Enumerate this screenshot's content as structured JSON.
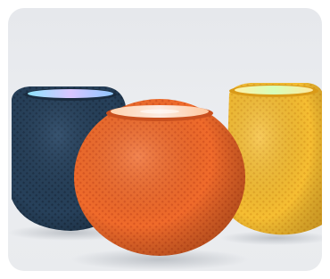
{
  "image": {
    "subject": "homepod-mini-speakers",
    "speakers": [
      {
        "name": "blue-speaker",
        "color": "#223a52"
      },
      {
        "name": "orange-speaker",
        "color": "#ee6a2a"
      },
      {
        "name": "yellow-speaker",
        "color": "#f2b62a"
      }
    ],
    "background_color": "#e8eaee"
  }
}
